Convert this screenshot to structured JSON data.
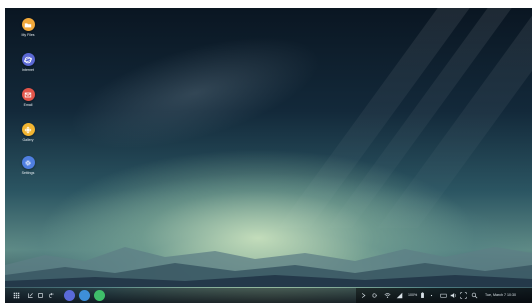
{
  "desktop": {
    "icons": [
      {
        "label": "My Files",
        "icon": "folder-icon",
        "color": "#f2a93b"
      },
      {
        "label": "Internet",
        "icon": "globe-icon",
        "color": "#5b68d4"
      },
      {
        "label": "Email",
        "icon": "envelope-icon",
        "color": "#e2554a"
      },
      {
        "label": "Gallery",
        "icon": "flower-icon",
        "color": "#f2b531"
      },
      {
        "label": "Settings",
        "icon": "gear-icon",
        "color": "#4f7fe0"
      }
    ]
  },
  "taskbar": {
    "buttons": [
      {
        "name": "apps-grid-icon"
      },
      {
        "name": "recent-apps-icon"
      },
      {
        "name": "home-icon"
      },
      {
        "name": "back-icon"
      }
    ],
    "pinned_apps": [
      {
        "name": "samsung-internet-icon",
        "color": "#5a6ad8"
      },
      {
        "name": "samsung-app-icon",
        "color": "#3e8fd9"
      },
      {
        "name": "phone-app-icon",
        "color": "#3fbf6a"
      }
    ]
  },
  "tray": {
    "battery_text": "100%",
    "datetime": "Tue, March 7 10:30"
  }
}
